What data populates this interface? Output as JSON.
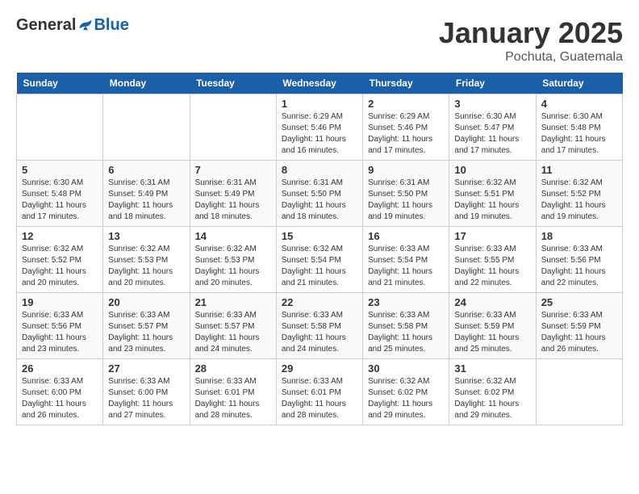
{
  "logo": {
    "general": "General",
    "blue": "Blue"
  },
  "title": "January 2025",
  "subtitle": "Pochuta, Guatemala",
  "days_of_week": [
    "Sunday",
    "Monday",
    "Tuesday",
    "Wednesday",
    "Thursday",
    "Friday",
    "Saturday"
  ],
  "weeks": [
    [
      {
        "day": "",
        "info": ""
      },
      {
        "day": "",
        "info": ""
      },
      {
        "day": "",
        "info": ""
      },
      {
        "day": "1",
        "info": "Sunrise: 6:29 AM\nSunset: 5:46 PM\nDaylight: 11 hours and 16 minutes."
      },
      {
        "day": "2",
        "info": "Sunrise: 6:29 AM\nSunset: 5:46 PM\nDaylight: 11 hours and 17 minutes."
      },
      {
        "day": "3",
        "info": "Sunrise: 6:30 AM\nSunset: 5:47 PM\nDaylight: 11 hours and 17 minutes."
      },
      {
        "day": "4",
        "info": "Sunrise: 6:30 AM\nSunset: 5:48 PM\nDaylight: 11 hours and 17 minutes."
      }
    ],
    [
      {
        "day": "5",
        "info": "Sunrise: 6:30 AM\nSunset: 5:48 PM\nDaylight: 11 hours and 17 minutes."
      },
      {
        "day": "6",
        "info": "Sunrise: 6:31 AM\nSunset: 5:49 PM\nDaylight: 11 hours and 18 minutes."
      },
      {
        "day": "7",
        "info": "Sunrise: 6:31 AM\nSunset: 5:49 PM\nDaylight: 11 hours and 18 minutes."
      },
      {
        "day": "8",
        "info": "Sunrise: 6:31 AM\nSunset: 5:50 PM\nDaylight: 11 hours and 18 minutes."
      },
      {
        "day": "9",
        "info": "Sunrise: 6:31 AM\nSunset: 5:50 PM\nDaylight: 11 hours and 19 minutes."
      },
      {
        "day": "10",
        "info": "Sunrise: 6:32 AM\nSunset: 5:51 PM\nDaylight: 11 hours and 19 minutes."
      },
      {
        "day": "11",
        "info": "Sunrise: 6:32 AM\nSunset: 5:52 PM\nDaylight: 11 hours and 19 minutes."
      }
    ],
    [
      {
        "day": "12",
        "info": "Sunrise: 6:32 AM\nSunset: 5:52 PM\nDaylight: 11 hours and 20 minutes."
      },
      {
        "day": "13",
        "info": "Sunrise: 6:32 AM\nSunset: 5:53 PM\nDaylight: 11 hours and 20 minutes."
      },
      {
        "day": "14",
        "info": "Sunrise: 6:32 AM\nSunset: 5:53 PM\nDaylight: 11 hours and 20 minutes."
      },
      {
        "day": "15",
        "info": "Sunrise: 6:32 AM\nSunset: 5:54 PM\nDaylight: 11 hours and 21 minutes."
      },
      {
        "day": "16",
        "info": "Sunrise: 6:33 AM\nSunset: 5:54 PM\nDaylight: 11 hours and 21 minutes."
      },
      {
        "day": "17",
        "info": "Sunrise: 6:33 AM\nSunset: 5:55 PM\nDaylight: 11 hours and 22 minutes."
      },
      {
        "day": "18",
        "info": "Sunrise: 6:33 AM\nSunset: 5:56 PM\nDaylight: 11 hours and 22 minutes."
      }
    ],
    [
      {
        "day": "19",
        "info": "Sunrise: 6:33 AM\nSunset: 5:56 PM\nDaylight: 11 hours and 23 minutes."
      },
      {
        "day": "20",
        "info": "Sunrise: 6:33 AM\nSunset: 5:57 PM\nDaylight: 11 hours and 23 minutes."
      },
      {
        "day": "21",
        "info": "Sunrise: 6:33 AM\nSunset: 5:57 PM\nDaylight: 11 hours and 24 minutes."
      },
      {
        "day": "22",
        "info": "Sunrise: 6:33 AM\nSunset: 5:58 PM\nDaylight: 11 hours and 24 minutes."
      },
      {
        "day": "23",
        "info": "Sunrise: 6:33 AM\nSunset: 5:58 PM\nDaylight: 11 hours and 25 minutes."
      },
      {
        "day": "24",
        "info": "Sunrise: 6:33 AM\nSunset: 5:59 PM\nDaylight: 11 hours and 25 minutes."
      },
      {
        "day": "25",
        "info": "Sunrise: 6:33 AM\nSunset: 5:59 PM\nDaylight: 11 hours and 26 minutes."
      }
    ],
    [
      {
        "day": "26",
        "info": "Sunrise: 6:33 AM\nSunset: 6:00 PM\nDaylight: 11 hours and 26 minutes."
      },
      {
        "day": "27",
        "info": "Sunrise: 6:33 AM\nSunset: 6:00 PM\nDaylight: 11 hours and 27 minutes."
      },
      {
        "day": "28",
        "info": "Sunrise: 6:33 AM\nSunset: 6:01 PM\nDaylight: 11 hours and 28 minutes."
      },
      {
        "day": "29",
        "info": "Sunrise: 6:33 AM\nSunset: 6:01 PM\nDaylight: 11 hours and 28 minutes."
      },
      {
        "day": "30",
        "info": "Sunrise: 6:32 AM\nSunset: 6:02 PM\nDaylight: 11 hours and 29 minutes."
      },
      {
        "day": "31",
        "info": "Sunrise: 6:32 AM\nSunset: 6:02 PM\nDaylight: 11 hours and 29 minutes."
      },
      {
        "day": "",
        "info": ""
      }
    ]
  ]
}
